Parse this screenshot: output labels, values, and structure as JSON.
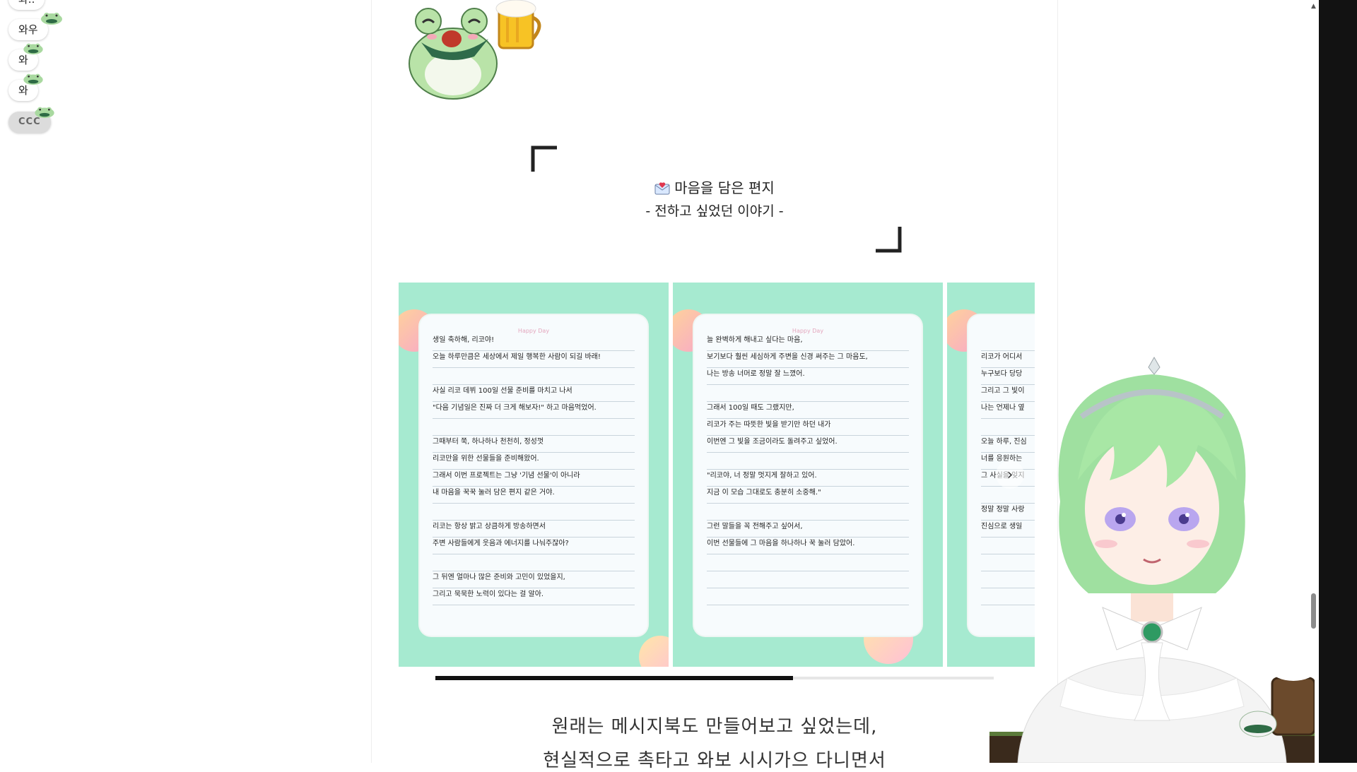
{
  "chat": {
    "chips": [
      "와..",
      "와우",
      "와",
      "와",
      "CCC"
    ]
  },
  "letters_section": {
    "title": "마음을 담은 편지",
    "subtitle": "- 전하고 싶었던 이야기 -",
    "envelope_icon": "love-letter-icon"
  },
  "cards": [
    {
      "header": "Happy Day",
      "lines": [
        "생일 축하해, 리코야!",
        "오늘 하루만큼은 세상에서 제일 행복한 사람이 되길 바래!",
        "",
        "사실 리코 데뷔 100일 선물 준비를 마치고 나서",
        "\"다음 기념일은 진짜 더 크게 해보자!\" 하고 마음먹었어.",
        "",
        "그때부터 쭉, 하나하나 천천히, 정성껏",
        "리코만을 위한 선물들을 준비해왔어.",
        "그래서 이번 프로젝트는 그냥 '기념 선물'이 아니라",
        "내 마음을 꾹꾹 눌러 담은 편지 같은 거야.",
        "",
        "리코는 항상 밝고 상큼하게 방송하면서",
        "주변 사람들에게 웃음과 에너지를 나눠주잖아?",
        "",
        "그 뒤엔 얼마나 많은 준비와 고민이 있었을지,",
        "그리고 묵묵한 노력이 있다는 걸 알아."
      ]
    },
    {
      "header": "Happy Day",
      "lines": [
        "늘 완벽하게 해내고 싶다는 마음,",
        "보기보다 훨씬 세심하게 주변을 신경 써주는 그 마음도,",
        "나는 방송 너머로 정말 잘 느꼈어.",
        "",
        "그래서 100일 때도 그랬지만,",
        "리코가 주는 따뜻한 빛을 받기만 하던 내가",
        "이번엔 그 빛을 조금이라도 돌려주고 싶었어.",
        "",
        "\"리코야, 너 정말 멋지게 잘하고 있어.",
        "지금 이 모습 그대로도 충분히 소중해.\"",
        "",
        "그런 말들을 꼭 전해주고 싶어서,",
        "이번 선물들에 그 마음을 하나하나 꾹 눌러 담았어.",
        "",
        "",
        ""
      ]
    },
    {
      "header": "",
      "lines": [
        "",
        "리코가 어디서",
        "누구보다 당당",
        "그리고 그 빛이",
        "나는 언제나 옆",
        "",
        "오늘 하루, 진심",
        "너를 응원하는",
        "그 사실을 잊지",
        "",
        "정말 정말 사랑",
        "진심으로 생일",
        "",
        "",
        "",
        ""
      ]
    }
  ],
  "carousel": {
    "next_icon": "chevron-right-icon",
    "progress": 0.64
  },
  "body_text": {
    "line1": "원래는 메시지북도 만들어보고 싶었는데,",
    "line2": "현실적으로 촉타고 와보 시시가으 다니면서"
  },
  "colors": {
    "card_bg": "#a6ead0",
    "paper_bg": "#f7fbfd",
    "progress_fill": "#111111",
    "accent_green": "#9ed9a4"
  }
}
